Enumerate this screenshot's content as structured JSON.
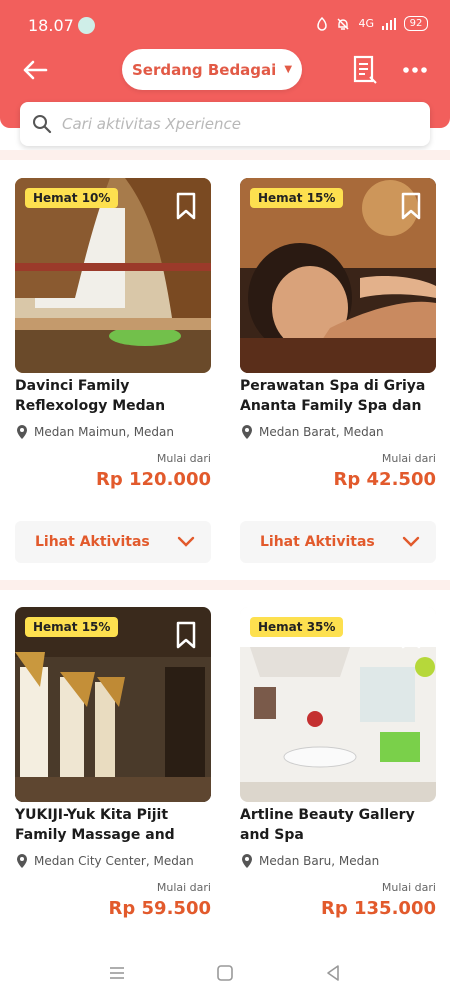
{
  "status": {
    "time": "18.07",
    "signal": "4G",
    "battery": "92"
  },
  "header": {
    "location": "Serdang Bedagai"
  },
  "search": {
    "placeholder": "Cari aktivitas Xperience"
  },
  "products": [
    {
      "badge": "Hemat 10%",
      "title": "Davinci Family Reflexology Medan",
      "location": "Medan Maimun, Medan",
      "price_label": "Mulai dari",
      "price": "Rp 120.000",
      "action": "Lihat Aktivitas"
    },
    {
      "badge": "Hemat 15%",
      "title": "Perawatan Spa di Griya Ananta Family Spa dan S...",
      "location": "Medan Barat, Medan",
      "price_label": "Mulai dari",
      "price": "Rp 42.500",
      "action": "Lihat Aktivitas"
    },
    {
      "badge": "Hemat 15%",
      "title": "YUKIJI-Yuk Kita Pijit Family Massage and Foot ...",
      "location": "Medan City Center, Medan",
      "price_label": "Mulai dari",
      "price": "Rp 59.500"
    },
    {
      "badge": "Hemat 35%",
      "title": "Artline Beauty Gallery and Spa",
      "location": "Medan Baru, Medan",
      "price_label": "Mulai dari",
      "price": "Rp 135.000"
    }
  ],
  "colors": {
    "brand": "#f25f5c",
    "price": "#e25a2c",
    "badge": "#fde04f"
  }
}
